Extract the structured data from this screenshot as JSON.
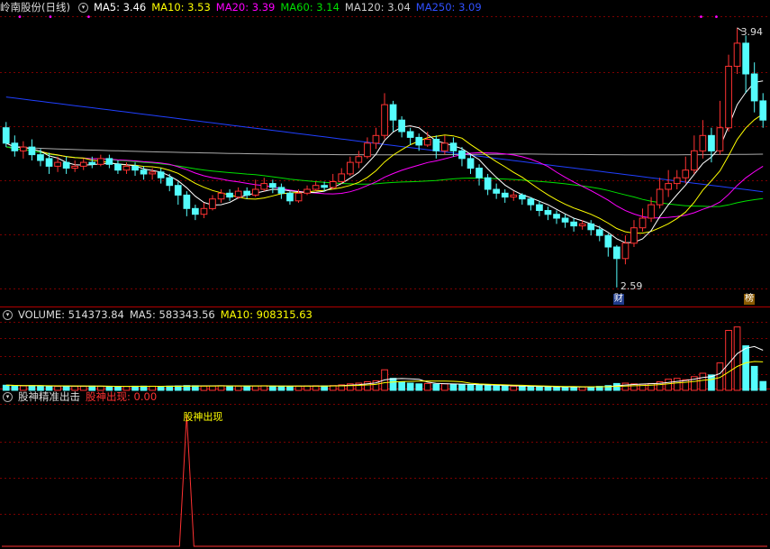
{
  "colors": {
    "bg": "#000000",
    "up": "#ff3232",
    "down": "#54fcfc",
    "grid": "#7a0000",
    "divider": "#b00000",
    "ma5": "#ffffff",
    "ma10": "#ffff00",
    "ma20": "#ff00ff",
    "ma60": "#00e000",
    "ma120": "#aaaaaa",
    "ma250": "#2040ff"
  },
  "main": {
    "title": "岭南股份(日线)",
    "indicators": [
      {
        "label": "MA5: 3.46",
        "color": "#ffffff"
      },
      {
        "label": "MA10: 3.53",
        "color": "#ffff00"
      },
      {
        "label": "MA20: 3.39",
        "color": "#ff00ff"
      },
      {
        "label": "MA60: 3.14",
        "color": "#00e000"
      },
      {
        "label": "MA120: 3.04",
        "color": "#cccccc"
      },
      {
        "label": "MA250: 3.09",
        "color": "#3050ff"
      }
    ],
    "high_label": "3.94",
    "low_label": "2.59",
    "tag_cai": "财",
    "tag_bang": "榜"
  },
  "volume": {
    "title": "VOLUME: 514373.84",
    "ma5": "MA5: 583343.56",
    "ma10": "MA10: 908315.63"
  },
  "indicator": {
    "title": "股神精准出击",
    "value": "股神出现: 0.00",
    "signal_label": "股神出现"
  },
  "chart_data": [
    {
      "type": "candlestick",
      "title": "岭南股份(日线)",
      "ylim": [
        2.5,
        4.0
      ],
      "candles": [
        [
          3.42,
          3.34,
          3.45,
          3.32
        ],
        [
          3.34,
          3.3,
          3.38,
          3.27
        ],
        [
          3.3,
          3.32,
          3.35,
          3.26
        ],
        [
          3.32,
          3.28,
          3.36,
          3.25
        ],
        [
          3.28,
          3.25,
          3.31,
          3.22
        ],
        [
          3.26,
          3.22,
          3.29,
          3.18
        ],
        [
          3.22,
          3.24,
          3.27,
          3.19
        ],
        [
          3.24,
          3.21,
          3.27,
          3.18
        ],
        [
          3.21,
          3.22,
          3.25,
          3.19
        ],
        [
          3.22,
          3.24,
          3.26,
          3.2
        ],
        [
          3.24,
          3.23,
          3.27,
          3.21
        ],
        [
          3.23,
          3.26,
          3.28,
          3.22
        ],
        [
          3.26,
          3.23,
          3.28,
          3.21
        ],
        [
          3.23,
          3.2,
          3.25,
          3.18
        ],
        [
          3.2,
          3.22,
          3.24,
          3.18
        ],
        [
          3.22,
          3.2,
          3.24,
          3.17
        ],
        [
          3.2,
          3.18,
          3.22,
          3.15
        ],
        [
          3.18,
          3.19,
          3.21,
          3.15
        ],
        [
          3.19,
          3.16,
          3.21,
          3.13
        ],
        [
          3.16,
          3.12,
          3.18,
          3.09
        ],
        [
          3.12,
          3.07,
          3.14,
          3.02
        ],
        [
          3.07,
          3.0,
          3.09,
          2.96
        ],
        [
          3.0,
          2.97,
          3.02,
          2.94
        ],
        [
          2.97,
          3.0,
          3.03,
          2.95
        ],
        [
          3.0,
          3.05,
          3.07,
          2.99
        ],
        [
          3.05,
          3.08,
          3.1,
          3.03
        ],
        [
          3.08,
          3.06,
          3.1,
          3.04
        ],
        [
          3.06,
          3.09,
          3.11,
          3.05
        ],
        [
          3.09,
          3.07,
          3.11,
          3.05
        ],
        [
          3.07,
          3.1,
          3.15,
          3.06
        ],
        [
          3.1,
          3.13,
          3.16,
          3.09
        ],
        [
          3.13,
          3.11,
          3.15,
          3.08
        ],
        [
          3.11,
          3.08,
          3.13,
          3.05
        ],
        [
          3.08,
          3.04,
          3.09,
          3.02
        ],
        [
          3.04,
          3.08,
          3.1,
          3.03
        ],
        [
          3.08,
          3.1,
          3.12,
          3.07
        ],
        [
          3.1,
          3.12,
          3.14,
          3.09
        ],
        [
          3.12,
          3.11,
          3.14,
          3.09
        ],
        [
          3.11,
          3.14,
          3.18,
          3.1
        ],
        [
          3.14,
          3.18,
          3.21,
          3.13
        ],
        [
          3.18,
          3.24,
          3.27,
          3.17
        ],
        [
          3.24,
          3.27,
          3.3,
          3.21
        ],
        [
          3.27,
          3.34,
          3.37,
          3.26
        ],
        [
          3.34,
          3.38,
          3.42,
          3.31
        ],
        [
          3.38,
          3.54,
          3.6,
          3.36
        ],
        [
          3.54,
          3.46,
          3.56,
          3.4
        ],
        [
          3.46,
          3.4,
          3.48,
          3.37
        ],
        [
          3.4,
          3.37,
          3.42,
          3.33
        ],
        [
          3.37,
          3.33,
          3.39,
          3.3
        ],
        [
          3.33,
          3.36,
          3.4,
          3.32
        ],
        [
          3.36,
          3.3,
          3.38,
          3.26
        ],
        [
          3.3,
          3.34,
          3.38,
          3.28
        ],
        [
          3.34,
          3.3,
          3.37,
          3.27
        ],
        [
          3.3,
          3.26,
          3.32,
          3.22
        ],
        [
          3.26,
          3.21,
          3.28,
          3.18
        ],
        [
          3.21,
          3.16,
          3.23,
          3.12
        ],
        [
          3.16,
          3.1,
          3.18,
          3.07
        ],
        [
          3.1,
          3.08,
          3.13,
          3.05
        ],
        [
          3.08,
          3.06,
          3.1,
          3.03
        ],
        [
          3.06,
          3.07,
          3.09,
          3.04
        ],
        [
          3.07,
          3.05,
          3.08,
          3.02
        ],
        [
          3.05,
          3.02,
          3.06,
          2.99
        ],
        [
          3.02,
          2.99,
          3.04,
          2.96
        ],
        [
          2.99,
          2.97,
          3.01,
          2.94
        ],
        [
          2.97,
          2.95,
          2.99,
          2.92
        ],
        [
          2.95,
          2.93,
          2.97,
          2.9
        ],
        [
          2.93,
          2.91,
          2.95,
          2.88
        ],
        [
          2.91,
          2.92,
          2.94,
          2.89
        ],
        [
          2.92,
          2.89,
          2.94,
          2.86
        ],
        [
          2.89,
          2.86,
          2.91,
          2.83
        ],
        [
          2.86,
          2.8,
          2.87,
          2.75
        ],
        [
          2.8,
          2.74,
          2.81,
          2.59
        ],
        [
          2.74,
          2.82,
          2.86,
          2.71
        ],
        [
          2.82,
          2.9,
          2.94,
          2.8
        ],
        [
          2.9,
          2.95,
          3.0,
          2.88
        ],
        [
          2.95,
          3.02,
          3.06,
          2.93
        ],
        [
          3.02,
          3.1,
          3.16,
          3.0
        ],
        [
          3.1,
          3.13,
          3.2,
          3.06
        ],
        [
          3.13,
          3.16,
          3.2,
          3.1
        ],
        [
          3.16,
          3.2,
          3.27,
          3.13
        ],
        [
          3.2,
          3.3,
          3.38,
          3.18
        ],
        [
          3.3,
          3.38,
          3.46,
          3.26
        ],
        [
          3.38,
          3.3,
          3.42,
          3.24
        ],
        [
          3.3,
          3.42,
          3.56,
          3.28
        ],
        [
          3.42,
          3.74,
          3.8,
          3.4
        ],
        [
          3.74,
          3.86,
          3.94,
          3.7
        ],
        [
          3.86,
          3.7,
          3.9,
          3.6
        ],
        [
          3.7,
          3.56,
          3.76,
          3.5
        ],
        [
          3.56,
          3.46,
          3.6,
          3.42
        ]
      ],
      "volumes": [
        300000,
        280000,
        260000,
        270000,
        250000,
        240000,
        230000,
        260000,
        240000,
        230000,
        250000,
        240000,
        230000,
        220000,
        230000,
        240000,
        250000,
        240000,
        230000,
        250000,
        260000,
        280000,
        270000,
        250000,
        260000,
        270000,
        260000,
        250000,
        240000,
        260000,
        270000,
        250000,
        240000,
        230000,
        250000,
        260000,
        270000,
        260000,
        280000,
        320000,
        380000,
        420000,
        500000,
        560000,
        1200000,
        700000,
        500000,
        420000,
        380000,
        400000,
        360000,
        380000,
        350000,
        330000,
        320000,
        300000,
        280000,
        260000,
        250000,
        240000,
        230000,
        220000,
        210000,
        200000,
        200000,
        190000,
        190000,
        200000,
        210000,
        230000,
        280000,
        400000,
        420000,
        380000,
        360000,
        400000,
        500000,
        650000,
        700000,
        620000,
        800000,
        1000000,
        900000,
        1600000,
        3500000,
        3700000,
        2600000,
        1400000,
        514373.84
      ],
      "volume_ylim": [
        0,
        4000000
      ],
      "signal": {
        "name": "股神出现",
        "index": 21,
        "value_shown": 0.0
      }
    }
  ]
}
